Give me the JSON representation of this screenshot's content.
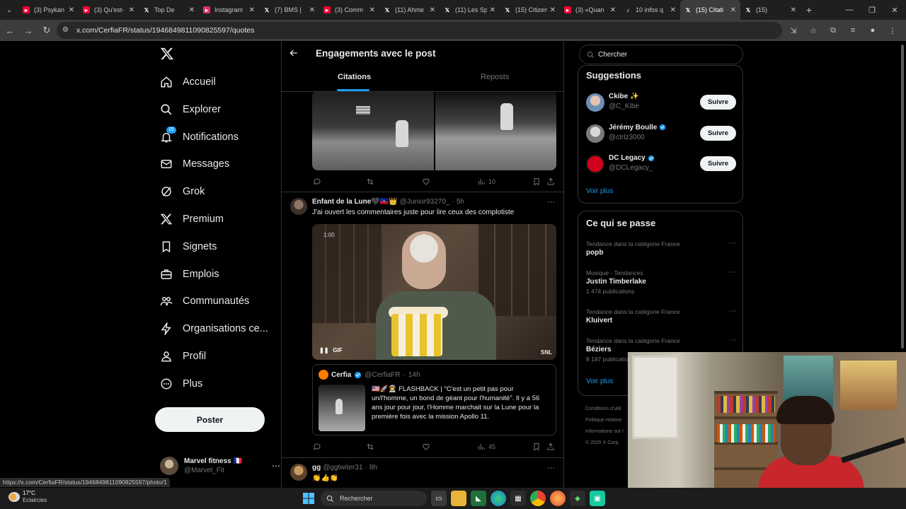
{
  "browser": {
    "tabs": [
      {
        "label": "(3) Psykan",
        "icon": "youtube-icon",
        "color": "#ff0033",
        "active": false
      },
      {
        "label": "(3) Qu'est-",
        "icon": "youtube-icon",
        "color": "#ff0033",
        "active": false
      },
      {
        "label": "Top De",
        "icon": "x-icon",
        "color": "#ffffff",
        "active": false
      },
      {
        "label": "Instagram",
        "icon": "instagram-icon",
        "color": "#e1306c",
        "active": false
      },
      {
        "label": "(7) BMS |",
        "icon": "x-icon",
        "color": "#ffffff",
        "active": false
      },
      {
        "label": "(3) Comm",
        "icon": "youtube-icon",
        "color": "#ff0033",
        "active": false
      },
      {
        "label": "(11) Ahme",
        "icon": "x-icon",
        "color": "#ffffff",
        "active": false
      },
      {
        "label": "(11) Les Sp",
        "icon": "x-icon",
        "color": "#ffffff",
        "active": false
      },
      {
        "label": "(15) Citizen",
        "icon": "x-icon",
        "color": "#ffffff",
        "active": false
      },
      {
        "label": "(3) «Quan",
        "icon": "youtube-icon",
        "color": "#ff0033",
        "active": false
      },
      {
        "label": "10 infos q",
        "icon": "tiktok-icon",
        "color": "#ffffff",
        "active": false
      },
      {
        "label": "(15) Citati",
        "icon": "x-icon",
        "color": "#ffffff",
        "active": true
      },
      {
        "label": "(15)",
        "icon": "x-icon",
        "color": "#ffffff",
        "active": false
      }
    ],
    "url": "x.com/CerfiaFR/status/1946849811090825597/quotes",
    "status_url": "https://x.com/CerfiaFR/status/1946849811090825597/photo/1"
  },
  "nav": {
    "items": [
      {
        "label": "Accueil",
        "icon": "home-icon"
      },
      {
        "label": "Explorer",
        "icon": "search-icon"
      },
      {
        "label": "Notifications",
        "icon": "bell-icon",
        "badge": "15"
      },
      {
        "label": "Messages",
        "icon": "mail-icon"
      },
      {
        "label": "Grok",
        "icon": "grok-icon"
      },
      {
        "label": "Premium",
        "icon": "x-icon"
      },
      {
        "label": "Signets",
        "icon": "bookmark-icon"
      },
      {
        "label": "Emplois",
        "icon": "briefcase-icon"
      },
      {
        "label": "Communautés",
        "icon": "people-icon"
      },
      {
        "label": "Organisations ce...",
        "icon": "lightning-icon"
      },
      {
        "label": "Profil",
        "icon": "person-icon"
      },
      {
        "label": "Plus",
        "icon": "more-circle-icon"
      }
    ],
    "post_label": "Poster",
    "account": {
      "name": "Marvel fitness 🇫🇷",
      "handle": "@Marvel_Fit"
    }
  },
  "header": {
    "title": "Engagements avec le post",
    "tabs": [
      "Citations",
      "Reposts"
    ]
  },
  "post1": {
    "views": "10"
  },
  "post2": {
    "name": "Enfant de la Lune🖤🇭🇹👑",
    "handle": "@Junior93270_",
    "time": "5h",
    "text": "J'ai ouvert les commentaires juste pour lire ceux des complotiste",
    "gif_label": "GIF",
    "gif_time": "1:00",
    "gif_watermark": "SNL",
    "views": "45",
    "quote": {
      "name": "Cerfia",
      "handle": "@CerfiaFR",
      "time": "14h",
      "text": "🇺🇸🚀👨‍🚀 FLASHBACK | \"C'est un petit pas pour un/l'homme, un bond de géant pour l'humanité\". Il y a 56 ans jour pour jour, l'Homme marchait sur la Lune pour la première fois avec la mission Apollo 11."
    }
  },
  "post3": {
    "name": "gg",
    "handle": "@ggtwiter31",
    "time": "8h",
    "text": "👏👍👏"
  },
  "search": {
    "placeholder": "Chercher"
  },
  "suggestions": {
    "title": "Suggestions",
    "follow_label": "Suivre",
    "see_more": "Voir plus",
    "items": [
      {
        "name": "Ckibe ✨",
        "handle": "@C_Kibe",
        "verified": false
      },
      {
        "name": "Jérémy Boulle",
        "handle": "@ctrlz3000",
        "verified": true
      },
      {
        "name": "DC Legacy",
        "handle": "@DCLegacy_",
        "verified": true
      }
    ]
  },
  "trends": {
    "title": "Ce qui se passe",
    "see_more": "Voir plus",
    "items": [
      {
        "category": "Tendance dans la catégorie France",
        "name": "popb",
        "count": ""
      },
      {
        "category": "Musique · Tendances",
        "name": "Justin Timberlake",
        "count": "1 474 publications"
      },
      {
        "category": "Tendance dans la catégorie France",
        "name": "Kluivert",
        "count": ""
      },
      {
        "category": "Tendance dans la catégorie France",
        "name": "Béziers",
        "count": "8 187 publications"
      }
    ]
  },
  "footer": [
    "Conditions d'utili",
    "Politique relative",
    "Informations sur l",
    "© 2025 X Corp."
  ],
  "taskbar": {
    "temperature": "17°C",
    "weather": "Eclaircies",
    "search_label": "Rechercher"
  }
}
